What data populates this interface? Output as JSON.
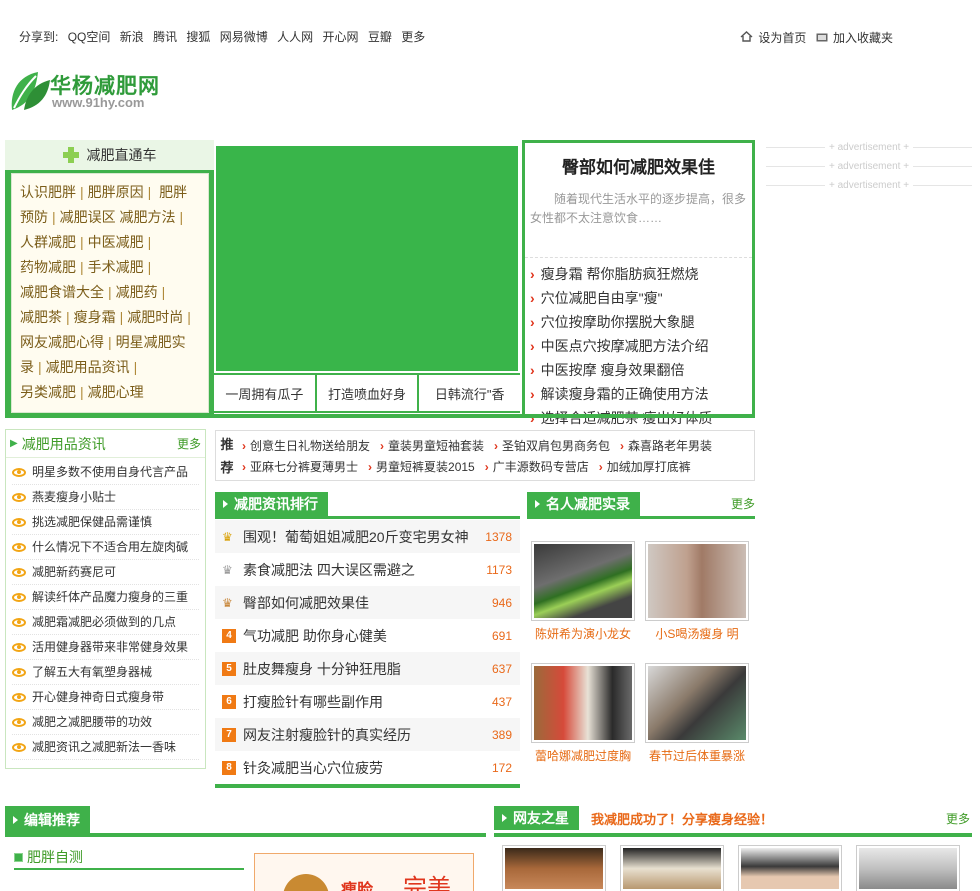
{
  "share": {
    "label": "分享到:",
    "items": [
      "QQ空间",
      "新浪",
      "腾讯",
      "搜狐",
      "网易微博",
      "人人网",
      "开心网",
      "豆瓣",
      "更多"
    ]
  },
  "toplinks": {
    "home": "设为首页",
    "fav": "加入收藏夹"
  },
  "logo": {
    "name": "华杨减肥网",
    "url": "www.91hy.com"
  },
  "ads": [
    "+ advertisement +",
    "+ advertisement +",
    "+ advertisement +"
  ],
  "nav": {
    "title": "减肥直通车",
    "links": [
      "认识肥胖",
      "肥胖原因",
      "肥胖预防",
      "减肥误区",
      "减肥方法",
      "人群减肥",
      "中医减肥",
      "药物减肥",
      "手术减肥",
      "减肥食谱大全",
      "减肥药",
      "减肥茶",
      "瘦身霜",
      "减肥时尚",
      "网友减肥心得",
      "明星减肥实录",
      "减肥用品资讯",
      "另类减肥",
      "减肥心理"
    ]
  },
  "slide_tabs": [
    "一周拥有瓜子",
    "打造喷血好身",
    "日韩流行\"香"
  ],
  "featured": {
    "title": "臀部如何减肥效果佳",
    "summary": "随着现代生活水平的逐步提高，很多女性都不太注意饮食……",
    "links": [
      "瘦身霜 帮你脂肪疯狂燃烧",
      "穴位减肥自由享\"瘦\"",
      "穴位按摩助你摆脱大象腿",
      "中医点穴按摩减肥方法介绍",
      "中医按摩 瘦身效果翻倍",
      "解读瘦身霜的正确使用方法",
      "选择合适减肥茶 瘦出好体质"
    ]
  },
  "products": {
    "title": "减肥用品资讯",
    "more": "更多",
    "items": [
      "明星多数不使用自身代言产品",
      "燕麦瘦身小贴士",
      "挑选减肥保健品需谨慎",
      "什么情况下不适合用左旋肉碱",
      "减肥新药赛尼可",
      "解读纤体产品魔力瘦身的三重",
      "减肥霜减肥必须做到的几点",
      "活用健身器带来非常健身效果",
      "了解五大有氧塑身器械",
      "开心健身神奇日式瘦身带",
      "减肥之减肥腰带的功效",
      "减肥资讯之减肥新法一香味"
    ]
  },
  "recommend": {
    "tag1": "推",
    "tag2": "荐",
    "row1": [
      "创意生日礼物送给朋友",
      "童装男童短袖套装",
      "圣铂双肩包男商务包",
      "森喜路老年男装"
    ],
    "row2": [
      "亚麻七分裤夏薄男士",
      "男童短裤夏装2015",
      "广丰源数码专营店",
      "加绒加厚打底裤"
    ]
  },
  "ranking": {
    "title": "减肥资讯排行",
    "items": [
      {
        "no": "1",
        "title": "围观！葡萄姐姐减肥20斤变宅男女神",
        "count": "1378"
      },
      {
        "no": "2",
        "title": "素食减肥法 四大误区需避之",
        "count": "1173"
      },
      {
        "no": "3",
        "title": "臀部如何减肥效果佳",
        "count": "946"
      },
      {
        "no": "4",
        "title": "气功减肥 助你身心健美",
        "count": "691"
      },
      {
        "no": "5",
        "title": "肚皮舞瘦身 十分钟狂甩脂",
        "count": "637"
      },
      {
        "no": "6",
        "title": "打瘦脸针有哪些副作用",
        "count": "437"
      },
      {
        "no": "7",
        "title": "网友注射瘦脸针的真实经历",
        "count": "389"
      },
      {
        "no": "8",
        "title": "针灸减肥当心穴位疲劳",
        "count": "172"
      }
    ]
  },
  "celebs": {
    "title": "名人减肥实录",
    "more": "更多",
    "items": [
      "陈妍希为演小龙女",
      "小S喝汤瘦身 明",
      "蕾哈娜减肥过度胸",
      "春节过后体重暴涨"
    ]
  },
  "editor": {
    "title": "编辑推荐",
    "sub": "肥胖自测",
    "banner_a": "瘦脸",
    "banner_b": "完美"
  },
  "stars": {
    "title": "网友之星",
    "slogan": "我减肥成功了！分享瘦身经验！",
    "more": "更多"
  },
  "colors": {
    "green": "#3fb14a",
    "orange": "#e9691a",
    "brown": "#7b5d19"
  }
}
